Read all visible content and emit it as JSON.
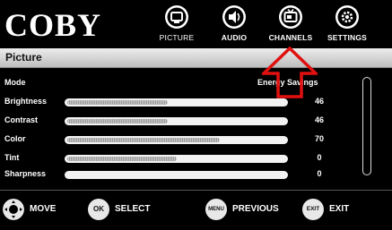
{
  "brand": "COBY",
  "nav": [
    {
      "label": "PICTURE",
      "icon": "picture-icon"
    },
    {
      "label": "AUDIO",
      "icon": "audio-icon"
    },
    {
      "label": "CHANNELS",
      "icon": "channels-icon"
    },
    {
      "label": "SETTINGS",
      "icon": "settings-icon"
    }
  ],
  "section_title": "Picture",
  "mode": {
    "label": "Mode",
    "value": "Energy Savings"
  },
  "settings": [
    {
      "label": "Brightness",
      "value": "46",
      "level": 0.46
    },
    {
      "label": "Contrast",
      "value": "46",
      "level": 0.46
    },
    {
      "label": "Color",
      "value": "70",
      "level": 0.7
    },
    {
      "label": "Tint",
      "value": "0",
      "level": 0.5
    },
    {
      "label": "Sharpness",
      "value": "0",
      "level": 0.0
    }
  ],
  "footer": {
    "move": {
      "icon_text": "",
      "label": "MOVE"
    },
    "select": {
      "icon_text": "OK",
      "label": "SELECT"
    },
    "previous": {
      "icon_text": "MENU",
      "label": "PREVIOUS"
    },
    "exit": {
      "icon_text": "EXIT",
      "label": "EXIT"
    }
  },
  "colors": {
    "annotation_arrow": "#e01010",
    "title_bar": "#d6d6d6"
  }
}
